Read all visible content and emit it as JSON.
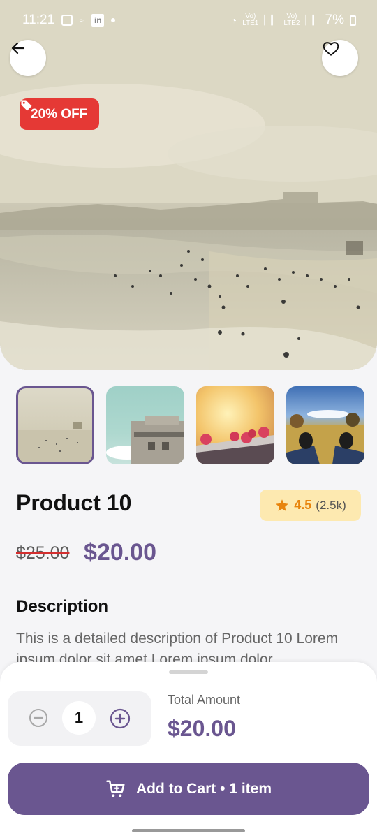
{
  "status_bar": {
    "time": "11:21",
    "linkedin": "in",
    "sim1": "Vo)\nLTE1",
    "sim2": "Vo)\nLTE2",
    "battery": "7%"
  },
  "header": {
    "back_icon": "arrow-left-icon",
    "favorite_icon": "heart-outline-icon"
  },
  "badge": {
    "discount_label": "20% OFF",
    "icon": "tag-icon"
  },
  "product": {
    "title": "Product 10",
    "rating": {
      "score": "4.5",
      "count": "(2.5k)",
      "icon": "star-icon"
    },
    "old_price": "$25.00",
    "new_price": "$20.00",
    "description_heading": "Description",
    "description_text": "This is a detailed description of Product 10 Lorem ipsum dolor sit amet Lorem ipsum dolor",
    "selected_image_index": 0
  },
  "bottom_sheet": {
    "quantity": "1",
    "minus_icon": "minus-circle-icon",
    "plus_icon": "plus-circle-icon",
    "total_label": "Total Amount",
    "total_value": "$20.00",
    "cart_button_label": "Add to Cart • 1 item",
    "cart_icon": "cart-icon"
  },
  "colors": {
    "accent": "#6a5690",
    "discount": "#e53935",
    "rating_bg": "#fde9b0",
    "rating_text": "#e8840c"
  }
}
